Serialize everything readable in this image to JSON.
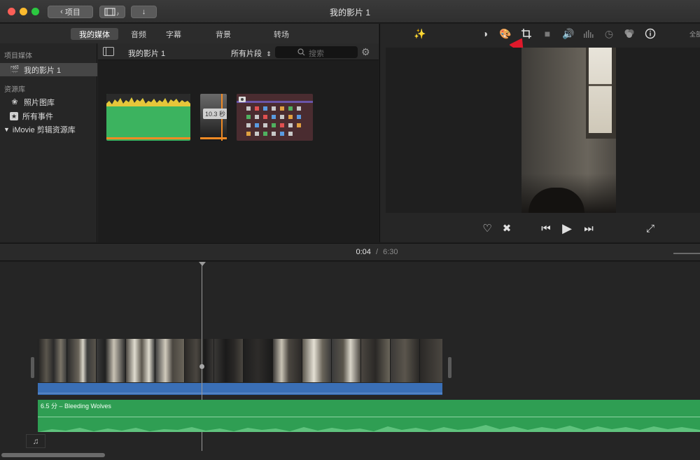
{
  "window": {
    "title": "我的影片 1",
    "back_button_label": "项目",
    "traffic_colors": [
      "#fc5f57",
      "#fdbb2e",
      "#2bc840"
    ]
  },
  "browser": {
    "tabs": [
      {
        "label": "我的媒体",
        "active": true
      },
      {
        "label": "音频",
        "active": false
      },
      {
        "label": "字幕",
        "active": false
      },
      {
        "label": "背景",
        "active": false
      },
      {
        "label": "转场",
        "active": false
      }
    ],
    "sidebar": {
      "project_media_heading": "项目媒体",
      "project_item": "我的影片 1",
      "library_heading": "资源库",
      "library_items": [
        "照片图库",
        "所有事件"
      ],
      "imovie_library": "iMovie 剪辑资源库"
    },
    "content_bar": {
      "current_title": "我的影片 1",
      "filter_label": "所有片段",
      "search_placeholder": "搜索"
    },
    "clips": {
      "duration_badge": "10.3 秒"
    }
  },
  "viewer": {
    "tools": [
      "magic-wand",
      "color-balance",
      "color-correction",
      "crop",
      "stabilization",
      "volume",
      "noise-reduction",
      "speed",
      "clip-filter",
      "info"
    ],
    "active_tool": "crop",
    "fullscreen_label_partial": "全部",
    "arrow_color": "#e0192b"
  },
  "timeline": {
    "current_time": "0:04",
    "separator": "/",
    "total_time": "6:30",
    "music_track_label": "6.5 分 –  Bleeding Wolves",
    "colors": {
      "audio_blue": "#3a6fb6",
      "music_green": "#2f9e53"
    }
  }
}
